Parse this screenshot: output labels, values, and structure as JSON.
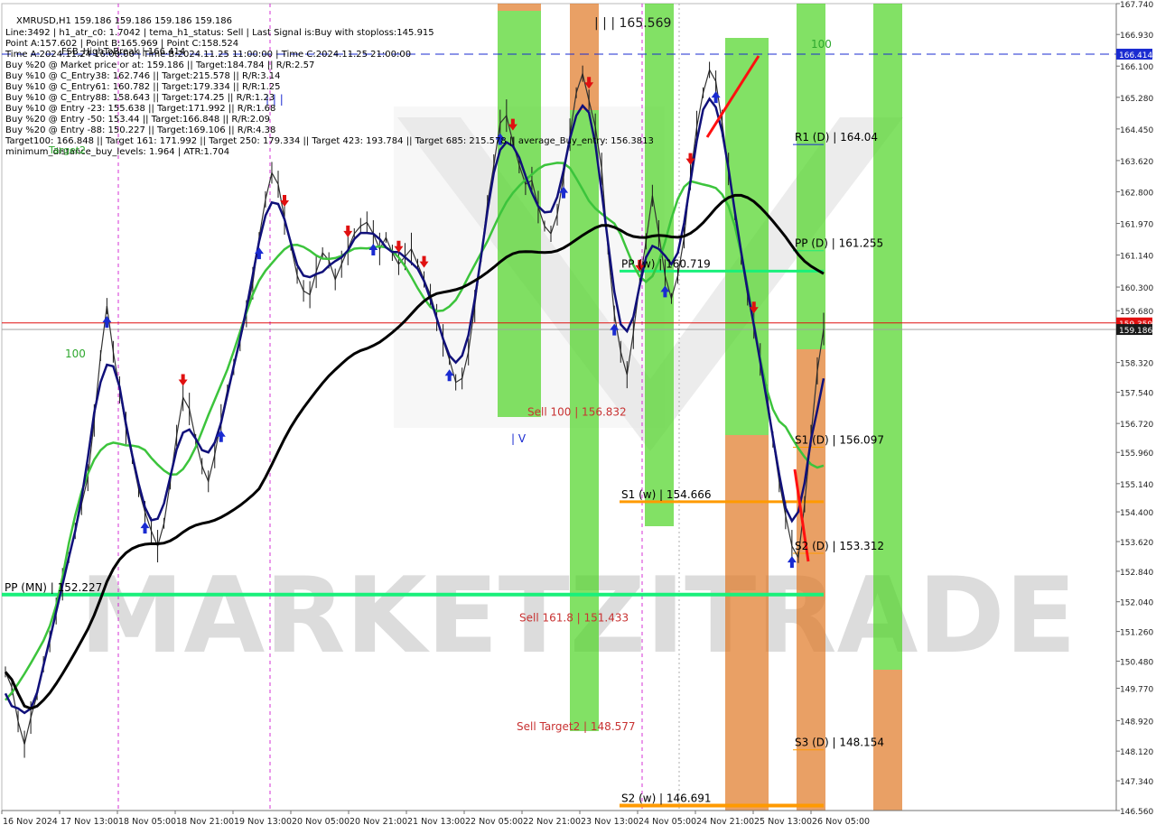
{
  "header": {
    "symbol_line": "XMRUSD,H1  159.186 159.186 159.186 159.186",
    "lines": [
      "Line:3492 | h1_atr_c0: 1.7042 | tema_h1_status: Sell | Last Signal is:Buy with stoploss:145.915",
      "Point A:157.602 | Point B:165.969 | Point C:158.524",
      "Time A:2024.11.24 16:00:00 | Time B:2024.11.25 11:00:00 | Time C:2024.11.25 21:00:00",
      "Buy %20 @ Market price or at: 159.186 || Target:184.784 || R/R:2.57",
      "Buy %10 @ C_Entry38: 162.746 || Target:215.578 || R/R:3.14",
      "Buy %10 @ C_Entry61: 160.782 || Target:179.334 || R/R:1.25",
      "Buy %10 @ C_Entry88: 158.643 || Target:174.25 || R/R:1.23",
      "Buy %10 @ Entry -23: 155.638 || Target:171.992 || R/R:1.68",
      "Buy %20 @ Entry -50: 153.44 || Target:166.848 || R/R:2.09",
      "Buy %20 @ Entry -88: 150.227 || Target:169.106 || R/R:4.38",
      "Target100: 166.848 || Target 161: 171.992 || Target 250: 179.334 || Target 423: 193.784 || Target 685: 215.578 || average_Buy_entry: 156.3813",
      "minimum_distance_buy_levels: 1.964 | ATR:1.704"
    ],
    "fsb_label": "FSB_HighToBreak | 166.414",
    "target2_label": "Target2"
  },
  "chart_data": {
    "type": "line",
    "title": "XMRUSD,H1",
    "ylim": [
      146.56,
      167.74
    ],
    "y_ticks": [
      "167.740",
      "166.930",
      "166.100",
      "165.280",
      "164.450",
      "163.620",
      "162.800",
      "161.970",
      "161.140",
      "160.300",
      "159.680",
      "158.320",
      "157.540",
      "156.720",
      "155.960",
      "155.140",
      "154.400",
      "153.620",
      "152.840",
      "152.040",
      "151.260",
      "150.480",
      "149.770",
      "148.920",
      "148.120",
      "147.340",
      "146.560"
    ],
    "x_ticks": [
      "16 Nov 2024",
      "17 Nov 13:00",
      "18 Nov 05:00",
      "18 Nov 21:00",
      "19 Nov 13:00",
      "20 Nov 05:00",
      "20 Nov 21:00",
      "21 Nov 13:00",
      "22 Nov 05:00",
      "22 Nov 21:00",
      "23 Nov 13:00",
      "24 Nov 05:00",
      "24 Nov 21:00",
      "25 Nov 13:00",
      "26 Nov 05:00"
    ],
    "current_price": 159.186,
    "red_line_price": 159.359,
    "fsb_price": 166.414,
    "price_tags": [
      {
        "text": "166.414",
        "value": 166.414,
        "color": "#1a2bd1"
      },
      {
        "text": "159.359",
        "value": 159.359,
        "color": "#e01010"
      },
      {
        "text": "159.186",
        "value": 159.186,
        "color": "#1a1a1a"
      }
    ],
    "levels": [
      {
        "label": "PP (MN) | 152.227",
        "value": 152.227
      },
      {
        "label": "PP (w) | 160.719",
        "value": 160.719
      },
      {
        "label": "S1 (w) | 154.666",
        "value": 154.666
      },
      {
        "label": "S2 (w) | 146.691",
        "value": 146.691
      },
      {
        "label": "R1 (D) | 164.04",
        "value": 164.04
      },
      {
        "label": "PP (D) | 161.255",
        "value": 161.255
      },
      {
        "label": "S1 (D) | 156.097",
        "value": 156.097
      },
      {
        "label": "S2 (D) | 153.312",
        "value": 153.312
      },
      {
        "label": "S3 (D) | 148.154",
        "value": 148.154
      },
      {
        "label": "Sell 100 | 156.832",
        "value": 156.832
      },
      {
        "label": "Sell 161.8 | 151.433",
        "value": 151.433
      },
      {
        "label": "Sell Target2 | 148.577",
        "value": 148.577
      }
    ],
    "top_annotation": "| | | 165.569",
    "wave_label_1": "| | |",
    "wave_label_2": "| V",
    "level_100_left": "100",
    "level_100_right": "100",
    "series": [
      {
        "name": "price",
        "values": [
          150.2,
          149.8,
          148.9,
          148.3,
          149.0,
          149.6,
          150.4,
          151.0,
          151.8,
          152.5,
          153.2,
          153.9,
          154.6,
          155.3,
          156.8,
          158.5,
          159.8,
          158.6,
          157.6,
          156.6,
          155.8,
          155.0,
          154.4,
          153.9,
          153.5,
          154.1,
          155.2,
          156.4,
          157.4,
          157.1,
          156.3,
          155.6,
          155.2,
          155.9,
          156.8,
          157.6,
          158.2,
          158.9,
          159.6,
          160.4,
          161.6,
          162.6,
          163.3,
          163.0,
          162.1,
          161.4,
          160.6,
          160.2,
          160.1,
          160.7,
          161.2,
          161.0,
          160.5,
          160.9,
          161.3,
          161.7,
          161.9,
          162.0,
          161.7,
          161.3,
          161.6,
          161.2,
          160.9,
          161.1,
          161.3,
          160.9,
          160.5,
          160.1,
          159.5,
          158.9,
          158.4,
          157.8,
          157.9,
          158.6,
          159.8,
          161.1,
          162.5,
          163.5,
          164.6,
          164.8,
          164.1,
          163.5,
          163.0,
          163.1,
          162.4,
          161.9,
          161.7,
          162.2,
          163.2,
          164.3,
          165.4,
          165.9,
          165.2,
          164.5,
          163.4,
          161.3,
          159.6,
          158.6,
          158.0,
          159.1,
          160.4,
          161.5,
          162.7,
          161.7,
          160.6,
          160.0,
          160.6,
          161.6,
          163.2,
          164.5,
          165.4,
          166.0,
          165.7,
          164.6,
          163.4,
          162.2,
          161.1,
          160.1,
          159.3,
          158.4,
          157.6,
          156.3,
          155.2,
          154.3,
          153.5,
          153.2,
          154.6,
          156.4,
          158.1,
          159.2
        ]
      }
    ]
  }
}
